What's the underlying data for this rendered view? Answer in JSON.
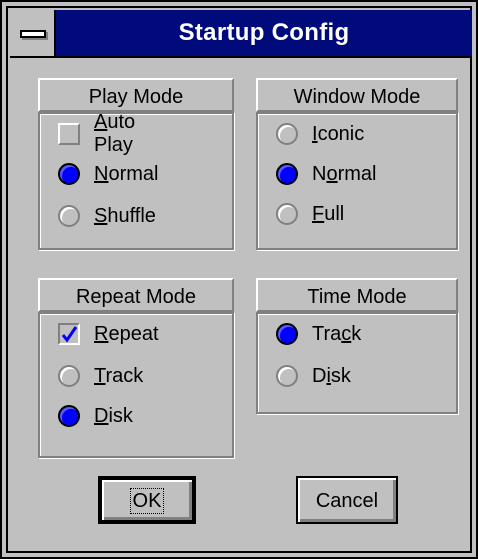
{
  "window": {
    "title": "Startup Config",
    "colors": {
      "titlebar": "#000a7b",
      "face": "#c0c0c0",
      "radio_selected": "#0000ff"
    }
  },
  "play_mode": {
    "header": "Play Mode",
    "options": [
      {
        "kind": "checkbox",
        "label_pre": "",
        "label_u": "A",
        "label_post": "uto Play",
        "checked": false
      },
      {
        "kind": "radio",
        "label_pre": "",
        "label_u": "N",
        "label_post": "ormal",
        "checked": true
      },
      {
        "kind": "radio",
        "label_pre": "",
        "label_u": "S",
        "label_post": "huffle",
        "checked": false
      }
    ]
  },
  "window_mode": {
    "header": "Window Mode",
    "options": [
      {
        "kind": "radio",
        "label_pre": "",
        "label_u": "I",
        "label_post": "conic",
        "checked": false
      },
      {
        "kind": "radio",
        "label_pre": "N",
        "label_u": "o",
        "label_post": "rmal",
        "checked": true
      },
      {
        "kind": "radio",
        "label_pre": "",
        "label_u": "F",
        "label_post": "ull",
        "checked": false
      }
    ]
  },
  "repeat_mode": {
    "header": "Repeat Mode",
    "options": [
      {
        "kind": "checkbox",
        "label_pre": "",
        "label_u": "R",
        "label_post": "epeat",
        "checked": true
      },
      {
        "kind": "radio",
        "label_pre": "",
        "label_u": "T",
        "label_post": "rack",
        "checked": false
      },
      {
        "kind": "radio",
        "label_pre": "",
        "label_u": "D",
        "label_post": "isk",
        "checked": true
      }
    ]
  },
  "time_mode": {
    "header": "Time Mode",
    "options": [
      {
        "kind": "radio",
        "label_pre": "Tra",
        "label_u": "c",
        "label_post": "k",
        "checked": true
      },
      {
        "kind": "radio",
        "label_pre": "D",
        "label_u": "i",
        "label_post": "sk",
        "checked": false
      }
    ]
  },
  "buttons": {
    "ok_label": "OK",
    "cancel_label": "Cancel"
  }
}
